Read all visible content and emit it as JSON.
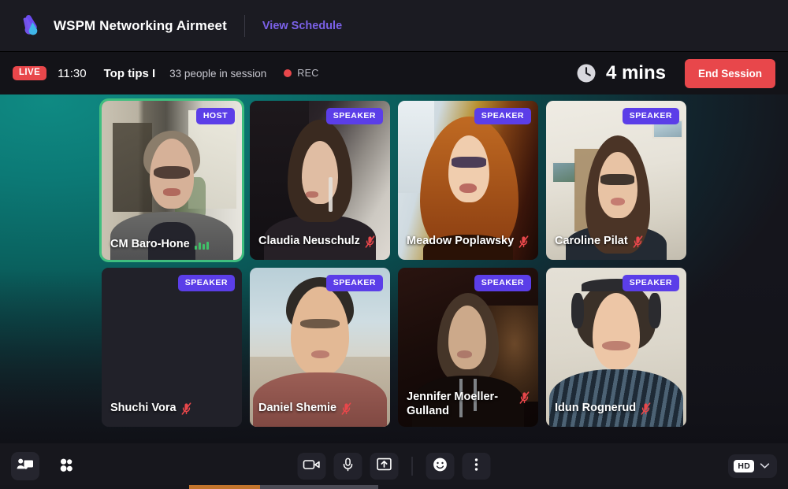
{
  "header": {
    "logo_icon": "airmeet-droplet-logo",
    "title": "WSPM Networking Airmeet",
    "view_schedule_label": "View Schedule"
  },
  "status_bar": {
    "live_label": "LIVE",
    "time": "11:30",
    "session_title": "Top tips I",
    "people_in_session": "33 people in session",
    "recording_label": "REC",
    "clock_icon": "clock-icon",
    "timer": "4 mins",
    "end_session_label": "End Session"
  },
  "colors": {
    "accent_purple": "#5b3ee8",
    "link_purple": "#7b61e8",
    "danger_red": "#e8474b",
    "active_speaker_green": "#3fbf7f",
    "stage_teal": "#0f8a83"
  },
  "participants": [
    {
      "name": "CM Baro-Hone",
      "badge": "HOST",
      "muted": false,
      "speaking": true,
      "camera_on": true
    },
    {
      "name": "Claudia Neuschulz",
      "badge": "SPEAKER",
      "muted": true,
      "speaking": false,
      "camera_on": true
    },
    {
      "name": "Meadow Poplawsky",
      "badge": "SPEAKER",
      "muted": true,
      "speaking": false,
      "camera_on": true
    },
    {
      "name": "Caroline Pilat",
      "badge": "SPEAKER",
      "muted": true,
      "speaking": false,
      "camera_on": true
    },
    {
      "name": "Shuchi Vora",
      "badge": "SPEAKER",
      "muted": true,
      "speaking": false,
      "camera_on": false
    },
    {
      "name": "Daniel Shemie",
      "badge": "SPEAKER",
      "muted": true,
      "speaking": false,
      "camera_on": true
    },
    {
      "name": "Jennifer Moeller-Gulland",
      "badge": "SPEAKER",
      "muted": true,
      "speaking": false,
      "camera_on": true
    },
    {
      "name": "Idun Rognerud",
      "badge": "SPEAKER",
      "muted": true,
      "speaking": false,
      "camera_on": true
    }
  ],
  "toolbar": {
    "layout_icon": "layout-presenter-icon",
    "participants_icon": "people-icon",
    "camera_icon": "video-camera-icon",
    "microphone_icon": "microphone-icon",
    "share_screen_icon": "share-screen-icon",
    "emoji_icon": "smiley-icon",
    "more_icon": "more-vertical-icon",
    "quality_label": "HD",
    "quality_chevron_icon": "chevron-down-icon"
  }
}
